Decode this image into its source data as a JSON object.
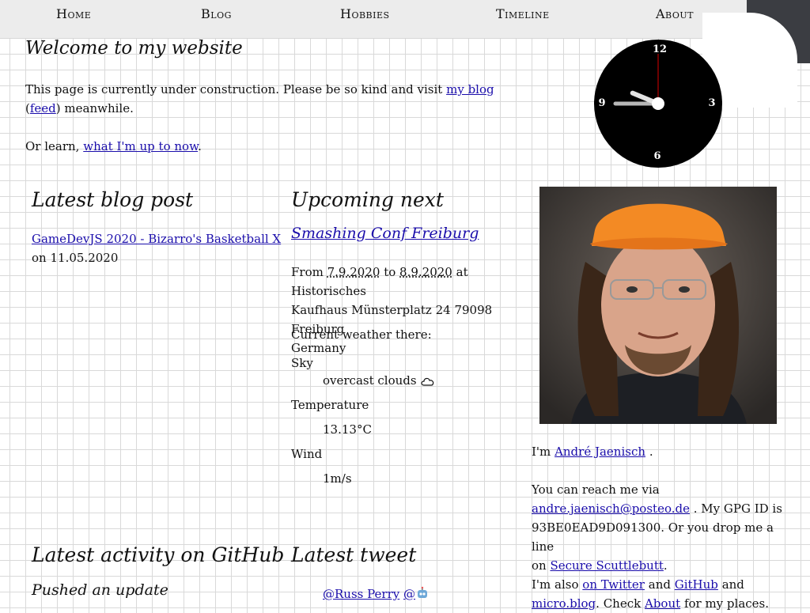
{
  "nav": {
    "items": [
      {
        "label": "Home"
      },
      {
        "label": "Blog"
      },
      {
        "label": "Hobbies"
      },
      {
        "label": "Timeline"
      },
      {
        "label": "About"
      }
    ]
  },
  "main": {
    "title": "Welcome to my website",
    "intro_text": "This page is currently under construction. Please be so kind and visit",
    "blog_link": "my blog",
    "paren_open": "(",
    "feed_link": "feed",
    "paren_close": ")",
    "meanwhile": "meanwhile.",
    "learn_text": "Or learn,",
    "now_link": "what I'm up to now",
    "learn_end": "."
  },
  "clock": {
    "numbers": {
      "n12": "12",
      "n3": "3",
      "n6": "6",
      "n9": "9"
    },
    "time_display": {
      "hour": 9,
      "minute": 45,
      "second": 0
    }
  },
  "blog_post": {
    "heading": "Latest blog post",
    "title": "GameDevJS 2020 - Bizarro's Basketball X",
    "date_prefix": "on",
    "date": "11.05.2020"
  },
  "upcoming": {
    "heading": "Upcoming next",
    "event_name": "Smashing Conf Freiburg",
    "from_label": "From",
    "from_date": "7.9.2020",
    "to_label": "to",
    "to_date": "8.9.2020",
    "location_line1": "at Historisches",
    "location_line2": "Kaufhaus Münsterplatz 24 79098 Freiburg",
    "location_line3": "Germany",
    "weather_label": "Current weather there:",
    "sky_label": "Sky",
    "sky_value": "overcast clouds",
    "temp_label": "Temperature",
    "temp_value": "13.13°C",
    "wind_label": "Wind",
    "wind_value": "1m/s"
  },
  "about": {
    "im_text": "I'm",
    "name_link": "André Jaenisch",
    "name_end": ".",
    "reach_text": "You can reach me via",
    "email_link": "andre.jaenisch@posteo.de",
    "gpg_text": ". My GPG ID is",
    "gpg_id": "93BE0EAD9D091300. Or you drop me a line",
    "on_text": "on",
    "scuttlebutt_link": "Secure Scuttlebutt",
    "sb_end": ".",
    "also_text": "I'm also",
    "twitter_link": "on Twitter",
    "and_text": "and",
    "github_link": "GitHub",
    "and_text2": "and",
    "microblog_link": "micro.blog",
    "check_text": ". Check",
    "about_link": "About",
    "places_text": "for my places."
  },
  "github": {
    "heading": "Latest activity on GitHub",
    "subheading": "Pushed an update"
  },
  "tweet": {
    "heading": "Latest tweet",
    "author": "@Russ Perry",
    "mention": "@"
  },
  "colors": {
    "link": "#1a0dab",
    "nav_bg": "#ececec",
    "corner": "#3b3d42",
    "cap": "#f38a24"
  }
}
